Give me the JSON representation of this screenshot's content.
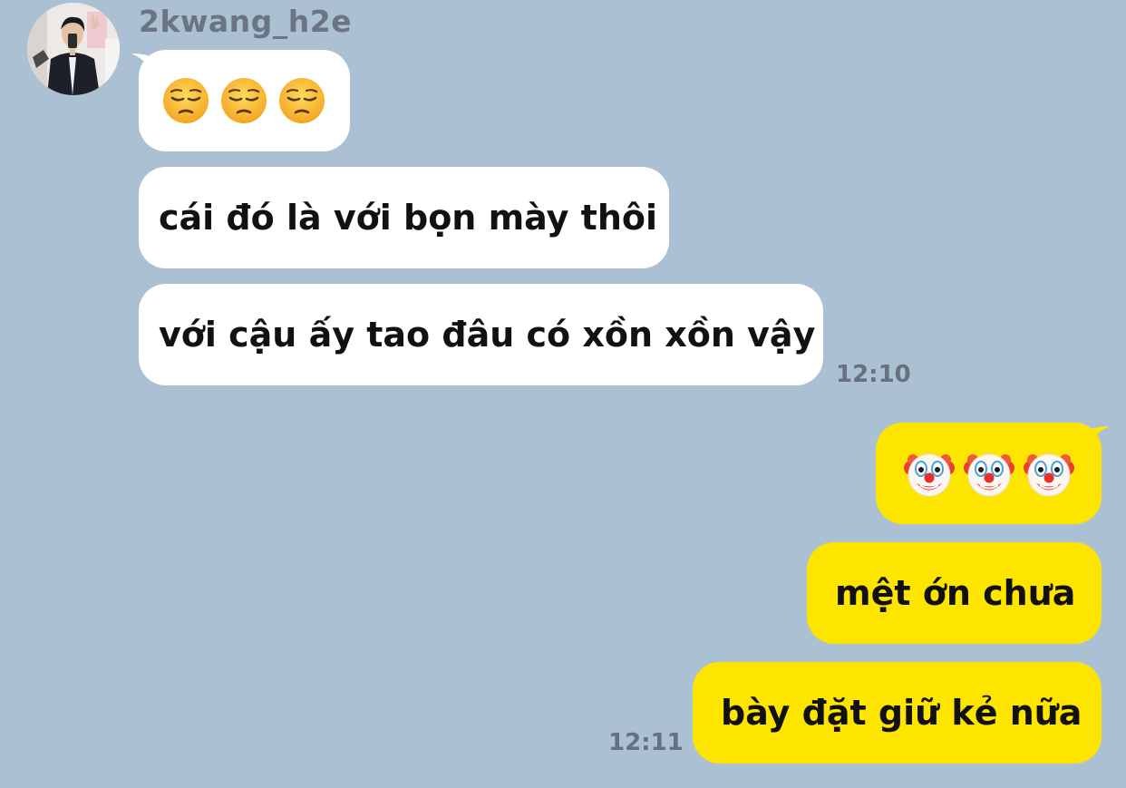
{
  "sender": {
    "name": "2kwang_h2e"
  },
  "messages_incoming": [
    {
      "type": "emoji",
      "emoji": [
        "😔",
        "😔",
        "😔"
      ],
      "icon": "pensive-face-icon"
    },
    {
      "type": "text",
      "text": "cái đó là với bọn mày thôi"
    },
    {
      "type": "text",
      "text": "với cậu ấy tao đâu có xồn xồn vậy"
    }
  ],
  "incoming_time": "12:10",
  "messages_outgoing": [
    {
      "type": "emoji",
      "emoji": [
        "🤡",
        "🤡",
        "🤡"
      ],
      "icon": "clown-face-icon"
    },
    {
      "type": "text",
      "text": "mệt ớn chưa"
    },
    {
      "type": "text",
      "text": "bày đặt giữ kẻ nữa"
    }
  ],
  "outgoing_time": "12:11",
  "colors": {
    "background": "#abc1d3",
    "incoming_bubble": "#ffffff",
    "outgoing_bubble": "#fee500",
    "timestamp": "#66717d",
    "sender_name": "#6b7480"
  }
}
